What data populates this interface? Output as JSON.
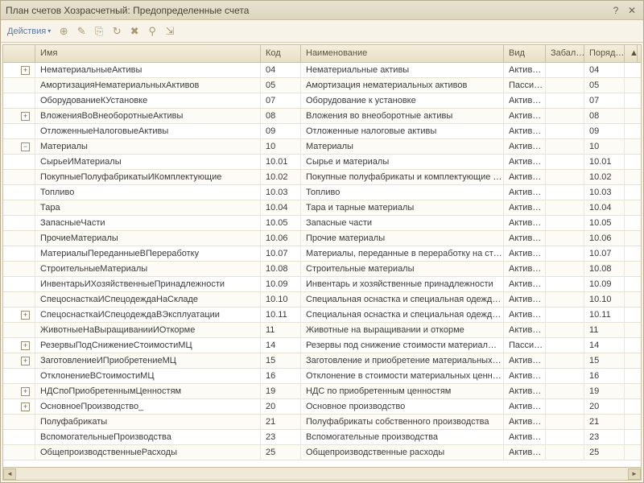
{
  "window": {
    "title": "План счетов Хозрасчетный: Предопределенные счета"
  },
  "toolbar": {
    "actions": "Действия"
  },
  "columns": {
    "name": "Имя",
    "code": "Код",
    "naim": "Наименование",
    "vid": "Вид",
    "zab": "Забал…",
    "por": "Поряд…"
  },
  "rows": [
    {
      "indent": 1,
      "tree": "plus",
      "name": "НематериальныеАктивы",
      "code": "04",
      "naim": "Нематериальные активы",
      "vid": "Актив…",
      "por": "04"
    },
    {
      "indent": 1,
      "tree": "",
      "name": "АмортизацияНематериальныхАктивов",
      "code": "05",
      "naim": "Амортизация нематериальных активов",
      "vid": "Пасси…",
      "por": "05"
    },
    {
      "indent": 1,
      "tree": "",
      "name": "ОборудованиеКУстановке",
      "code": "07",
      "naim": "Оборудование к установке",
      "vid": "Актив…",
      "por": "07"
    },
    {
      "indent": 1,
      "tree": "plus",
      "name": "ВложенияВоВнеоборотныеАктивы",
      "code": "08",
      "naim": "Вложения во внеоборотные активы",
      "vid": "Актив…",
      "por": "08"
    },
    {
      "indent": 1,
      "tree": "",
      "name": "ОтложенныеНалоговыеАктивы",
      "code": "09",
      "naim": "Отложенные налоговые активы",
      "vid": "Актив…",
      "por": "09"
    },
    {
      "indent": 1,
      "tree": "minus",
      "name": "Материалы",
      "code": "10",
      "naim": "Материалы",
      "vid": "Актив…",
      "por": "10"
    },
    {
      "indent": 2,
      "tree": "",
      "name": "СырьеИМатериалы",
      "code": "10.01",
      "naim": "Сырье и материалы",
      "vid": "Актив…",
      "por": "10.01"
    },
    {
      "indent": 2,
      "tree": "",
      "name": "ПокупныеПолуфабрикатыИКомплектующие",
      "code": "10.02",
      "naim": "Покупные полуфабрикаты и комплектующие …",
      "vid": "Актив…",
      "por": "10.02"
    },
    {
      "indent": 2,
      "tree": "",
      "name": "Топливо",
      "code": "10.03",
      "naim": "Топливо",
      "vid": "Актив…",
      "por": "10.03"
    },
    {
      "indent": 2,
      "tree": "",
      "name": "Тара",
      "code": "10.04",
      "naim": "Тара и тарные материалы",
      "vid": "Актив…",
      "por": "10.04"
    },
    {
      "indent": 2,
      "tree": "",
      "name": "ЗапасныеЧасти",
      "code": "10.05",
      "naim": "Запасные части",
      "vid": "Актив…",
      "por": "10.05"
    },
    {
      "indent": 2,
      "tree": "",
      "name": "ПрочиеМатериалы",
      "code": "10.06",
      "naim": "Прочие материалы",
      "vid": "Актив…",
      "por": "10.06"
    },
    {
      "indent": 2,
      "tree": "",
      "name": "МатериалыПереданныеВПереработку",
      "code": "10.07",
      "naim": "Материалы, переданные в переработку на ст…",
      "vid": "Актив…",
      "por": "10.07"
    },
    {
      "indent": 2,
      "tree": "",
      "name": "СтроительныеМатериалы",
      "code": "10.08",
      "naim": "Строительные материалы",
      "vid": "Актив…",
      "por": "10.08"
    },
    {
      "indent": 2,
      "tree": "",
      "name": "ИнвентарьИХозяйственныеПринадлежности",
      "code": "10.09",
      "naim": "Инвентарь и хозяйственные принадлежности",
      "vid": "Актив…",
      "por": "10.09"
    },
    {
      "indent": 2,
      "tree": "",
      "name": "СпецоснасткаИСпецодеждаНаСкладе",
      "code": "10.10",
      "naim": "Специальная оснастка и специальная одежд…",
      "vid": "Актив…",
      "por": "10.10"
    },
    {
      "indent": 2,
      "tree": "plus",
      "name": "СпецоснасткаИСпецодеждаВЭксплуатации",
      "code": "10.11",
      "naim": "Специальная оснастка и специальная одежд…",
      "vid": "Актив…",
      "por": "10.11"
    },
    {
      "indent": 1,
      "tree": "",
      "name": "ЖивотныеНаВыращиванииИОткорме",
      "code": "11",
      "naim": "Животные на выращивании и откорме",
      "vid": "Актив…",
      "por": "11"
    },
    {
      "indent": 1,
      "tree": "plus",
      "name": "РезервыПодСнижениеСтоимостиМЦ",
      "code": "14",
      "naim": "Резервы под снижение стоимости материал…",
      "vid": "Пасси…",
      "por": "14"
    },
    {
      "indent": 1,
      "tree": "plus",
      "name": "ЗаготовлениеИПриобретениеМЦ",
      "code": "15",
      "naim": "Заготовление и приобретение материальных…",
      "vid": "Актив…",
      "por": "15"
    },
    {
      "indent": 1,
      "tree": "",
      "name": "ОтклонениеВСтоимостиМЦ",
      "code": "16",
      "naim": "Отклонение в стоимости материальных ценн…",
      "vid": "Актив…",
      "por": "16"
    },
    {
      "indent": 1,
      "tree": "plus",
      "name": "НДСпоПриобретеннымЦенностям",
      "code": "19",
      "naim": "НДС по приобретенным ценностям",
      "vid": "Актив…",
      "por": "19"
    },
    {
      "indent": 1,
      "tree": "plus",
      "name": "ОсновноеПроизводство_",
      "code": "20",
      "naim": "Основное производство",
      "vid": "Актив…",
      "por": "20"
    },
    {
      "indent": 1,
      "tree": "",
      "name": "Полуфабрикаты",
      "code": "21",
      "naim": "Полуфабрикаты собственного производства",
      "vid": "Актив…",
      "por": "21"
    },
    {
      "indent": 1,
      "tree": "",
      "name": "ВспомогательныеПроизводства",
      "code": "23",
      "naim": "Вспомогательные производства",
      "vid": "Актив…",
      "por": "23"
    },
    {
      "indent": 1,
      "tree": "",
      "name": "ОбщепроизводственныеРасходы",
      "code": "25",
      "naim": "Общепроизводственные расходы",
      "vid": "Актив…",
      "por": "25"
    }
  ]
}
